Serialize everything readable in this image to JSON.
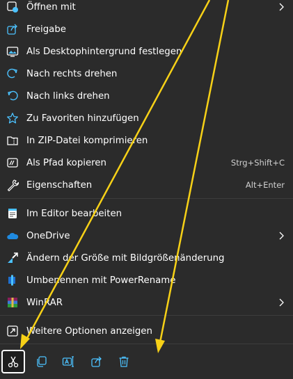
{
  "menu": {
    "items": [
      {
        "label": "Öffnen mit",
        "icon": "open-with-icon",
        "shortcut": "",
        "submenu": true
      },
      {
        "label": "Freigabe",
        "icon": "share-icon",
        "shortcut": "",
        "submenu": false
      },
      {
        "label": "Als Desktophintergrund festlegen",
        "icon": "wallpaper-icon",
        "shortcut": "",
        "submenu": false
      },
      {
        "label": "Nach rechts drehen",
        "icon": "rotate-right-icon",
        "shortcut": "",
        "submenu": false
      },
      {
        "label": "Nach links drehen",
        "icon": "rotate-left-icon",
        "shortcut": "",
        "submenu": false
      },
      {
        "label": "Zu Favoriten hinzufügen",
        "icon": "star-icon",
        "shortcut": "",
        "submenu": false
      },
      {
        "label": "In ZIP-Datei komprimieren",
        "icon": "zip-icon",
        "shortcut": "",
        "submenu": false
      },
      {
        "label": "Als Pfad kopieren",
        "icon": "copy-path-icon",
        "shortcut": "Strg+Shift+C",
        "submenu": false
      },
      {
        "label": "Eigenschaften",
        "icon": "wrench-icon",
        "shortcut": "Alt+Enter",
        "submenu": false
      },
      {
        "label": "Im Editor bearbeiten",
        "icon": "notepad-icon",
        "shortcut": "",
        "submenu": false
      },
      {
        "label": "OneDrive",
        "icon": "onedrive-icon",
        "shortcut": "",
        "submenu": true
      },
      {
        "label": "Ändern der Größe mit Bildgrößenänderung",
        "icon": "image-resizer-icon",
        "shortcut": "",
        "submenu": false
      },
      {
        "label": "Umbenennen mit PowerRename",
        "icon": "powerrename-icon",
        "shortcut": "",
        "submenu": false
      },
      {
        "label": "WinRAR",
        "icon": "winrar-icon",
        "shortcut": "",
        "submenu": true
      },
      {
        "label": "Weitere Optionen anzeigen",
        "icon": "more-options-icon",
        "shortcut": "",
        "submenu": false
      }
    ]
  },
  "toolbar": {
    "buttons": [
      {
        "name": "cut-button",
        "icon": "scissors-icon",
        "selected": true
      },
      {
        "name": "copy-button",
        "icon": "copy-icon",
        "selected": false
      },
      {
        "name": "rename-button",
        "icon": "rename-icon",
        "selected": false
      },
      {
        "name": "share-button",
        "icon": "share-icon",
        "selected": false
      },
      {
        "name": "delete-button",
        "icon": "trash-icon",
        "selected": false
      }
    ]
  },
  "colors": {
    "menu_bg": "#2b2b2b",
    "text": "#ffffff",
    "accent_icon": "#4cc2ff",
    "annotation_arrow": "#f7d117",
    "separator": "#3d3d3d"
  }
}
